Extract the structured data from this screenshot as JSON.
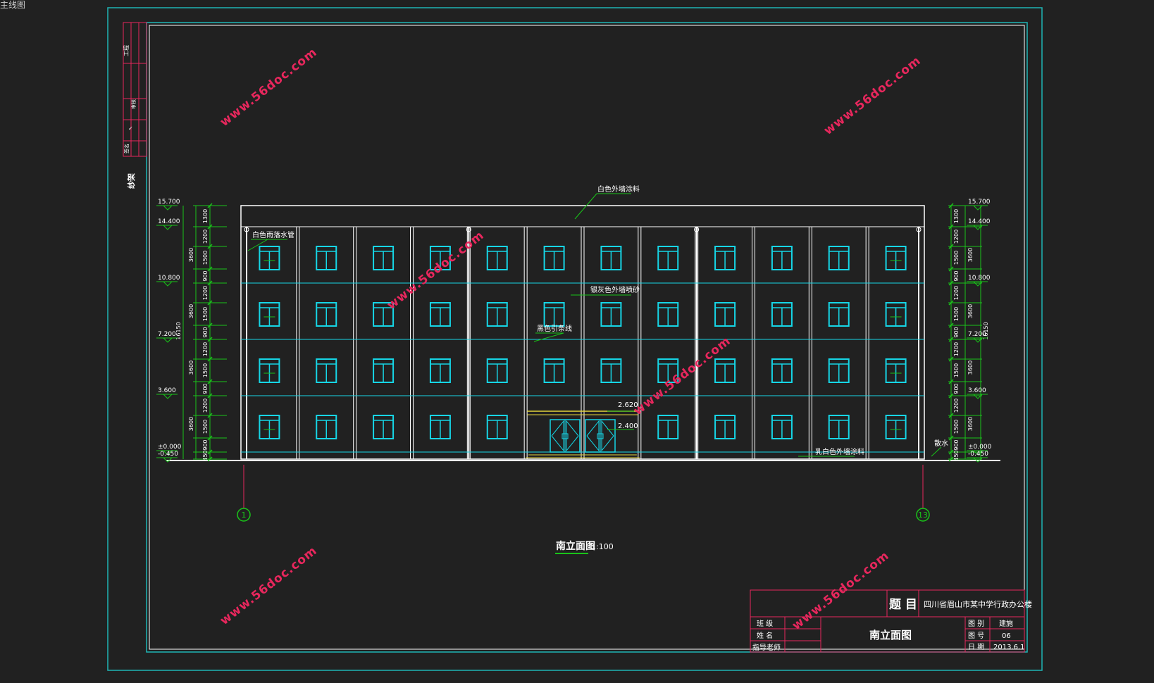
{
  "window_label": "主线图",
  "floor_label": "纱架",
  "colors": {
    "background": "#212121",
    "frame": "#1fb5b5",
    "building": "#ffffff",
    "window": "#16d6e6",
    "dimension": "#19c419",
    "annotation": "#ffffff",
    "watermark": "#e8275d",
    "yellow": "#e3d43a"
  },
  "watermark": "www.56doc.com",
  "elevations": {
    "left": [
      "15.700",
      "14.400",
      "10.800",
      "7.200",
      "3.600",
      "±0.000",
      "-0.450"
    ],
    "right": [
      "15.700",
      "14.400",
      "10.800",
      "7.200",
      "3.600",
      "±0.000",
      "-0.450"
    ]
  },
  "dims": {
    "segments": [
      "1300",
      "1200",
      "1500",
      "900",
      "1200",
      "1500",
      "900",
      "1200",
      "1500",
      "900",
      "1200",
      "1500",
      "900",
      "450"
    ],
    "floor_heights": [
      "3600",
      "3600",
      "3600",
      "3600"
    ],
    "total": "16150"
  },
  "labels": {
    "roof_paint": "白色外墙涂料",
    "downpipe": "白色雨落水管",
    "grey_wall": "银灰色外墙喷砂",
    "black_line": "黑色引条线",
    "canopy_top": "2.620",
    "canopy_bottom": "2.400",
    "plinth": "乳白色外墙涂料",
    "apron": "散水"
  },
  "axes": {
    "left": "1",
    "right": "13"
  },
  "drawing_title": {
    "name": "南立面图",
    "scale": "1:100"
  },
  "title_block": {
    "topic_label": "题 目",
    "topic_value": "四川省眉山市某中学行政办公楼",
    "class_label": "班 级",
    "name_label": "姓 名",
    "advisor_label": "指导老师",
    "sheet_name": "南立面图",
    "category_label": "图 别",
    "category_value": "建施",
    "number_label": "图 号",
    "number_value": "06",
    "date_label": "日 期",
    "date_value": "2013.6.1"
  }
}
